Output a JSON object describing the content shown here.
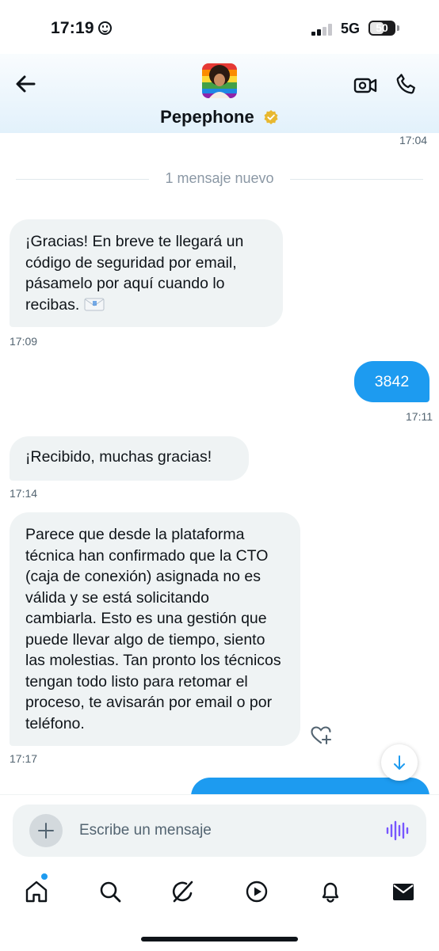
{
  "status_bar": {
    "time": "17:19",
    "network": "5G",
    "battery": "50"
  },
  "header": {
    "name": "Pepephone",
    "verified": true,
    "avatar": "profile-picture"
  },
  "colors": {
    "accent": "#1d9bf0",
    "incoming_bubble": "#eff3f4",
    "verified": "#e8b830",
    "voice": "#7856ff"
  },
  "conversation": {
    "top_timestamp": "17:04",
    "new_messages_divider": "1 mensaje nuevo",
    "messages": [
      {
        "direction": "in",
        "text": "¡Gracias! En breve te llegará un código de seguridad por email, pásamelo por aquí cuando lo recibas.",
        "emoji": "envelope-icon",
        "time": "17:09"
      },
      {
        "direction": "out",
        "text": "3842",
        "time": "17:11"
      },
      {
        "direction": "in",
        "text": "¡Recibido, muchas gracias!",
        "time": "17:14"
      },
      {
        "direction": "in",
        "text": "Parece que desde la plataforma técnica han confirmado que la CTO (caja de conexión) asignada no es válida y se está solicitando cambiarla. Esto es una gestión que puede llevar algo de tiempo, siento las molestias. Tan pronto los técnicos tengan todo listo para retomar el proceso, te avisarán por email o por teléfono.",
        "time": "17:17"
      }
    ]
  },
  "composer": {
    "placeholder": "Escribe un mensaje"
  },
  "tab_bar": {
    "items": [
      "home-icon",
      "search-icon",
      "grok-icon",
      "play-icon",
      "bell-icon",
      "mail-icon"
    ]
  }
}
